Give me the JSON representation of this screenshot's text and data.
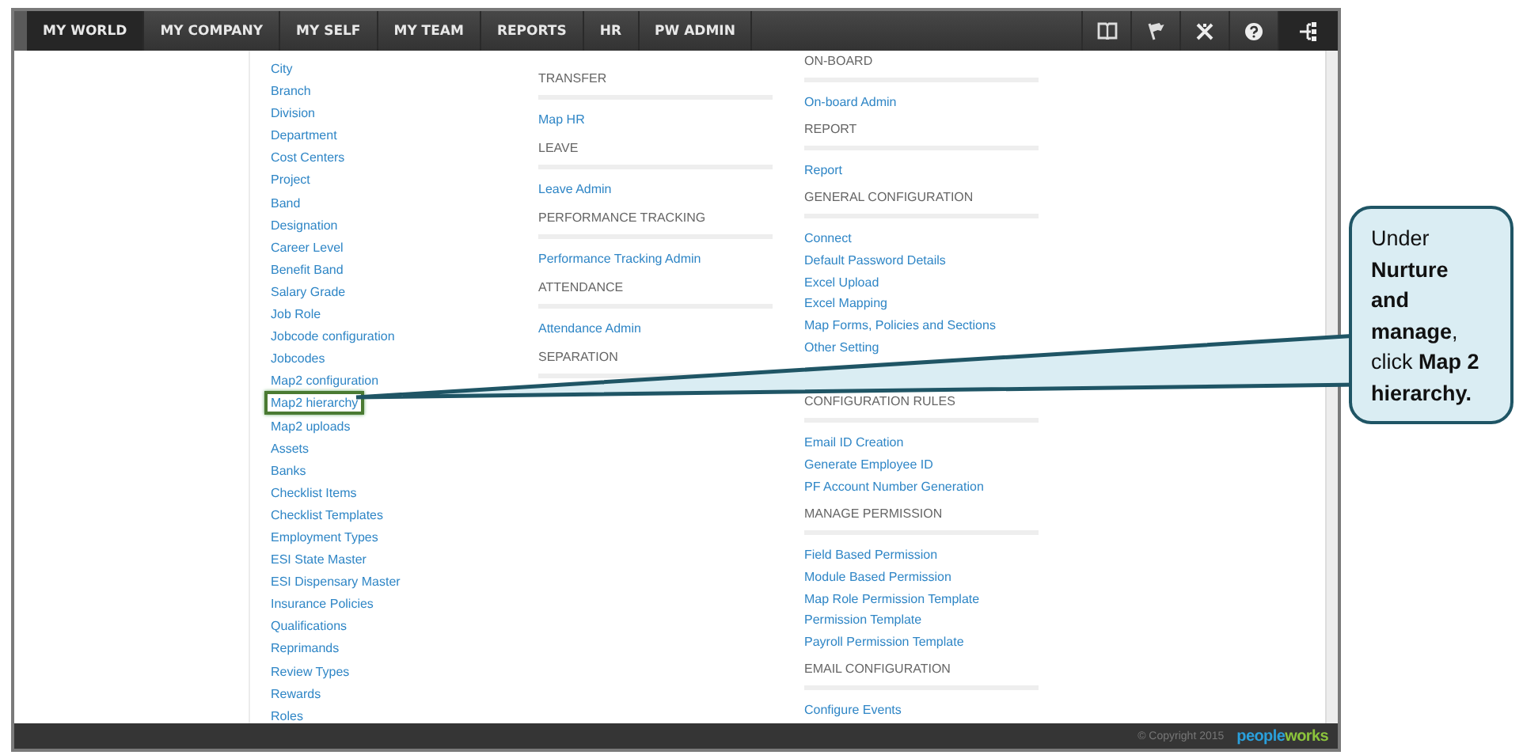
{
  "nav": {
    "tabs": [
      {
        "label": "MY WORLD",
        "selected": true
      },
      {
        "label": "MY COMPANY",
        "selected": false
      },
      {
        "label": "MY SELF",
        "selected": false
      },
      {
        "label": "MY TEAM",
        "selected": false
      },
      {
        "label": "REPORTS",
        "selected": false
      },
      {
        "label": "HR",
        "selected": false
      },
      {
        "label": "PW ADMIN",
        "selected": false
      }
    ],
    "icons": [
      {
        "kind": "book",
        "selected": false
      },
      {
        "kind": "flag",
        "selected": false
      },
      {
        "kind": "tools",
        "selected": false
      },
      {
        "kind": "help",
        "selected": false
      },
      {
        "kind": "hierarchy",
        "selected": true
      }
    ]
  },
  "column_1": {
    "items": [
      {
        "label": "City",
        "highlighted": false
      },
      {
        "label": "Branch",
        "highlighted": false
      },
      {
        "label": "Division",
        "highlighted": false
      },
      {
        "label": "Department",
        "highlighted": false
      },
      {
        "label": "Cost Centers",
        "highlighted": false
      },
      {
        "label": "Project",
        "highlighted": false
      },
      {
        "label": "Band",
        "highlighted": false
      },
      {
        "label": "Designation",
        "highlighted": false
      },
      {
        "label": "Career Level",
        "highlighted": false
      },
      {
        "label": "Benefit Band",
        "highlighted": false
      },
      {
        "label": "Salary Grade",
        "highlighted": false
      },
      {
        "label": "Job Role",
        "highlighted": false
      },
      {
        "label": "Jobcode configuration",
        "highlighted": false
      },
      {
        "label": "Jobcodes",
        "highlighted": false
      },
      {
        "label": "Map2 configuration",
        "highlighted": false
      },
      {
        "label": "Map2 hierarchy",
        "highlighted": true
      },
      {
        "label": "Map2 uploads",
        "highlighted": false
      },
      {
        "label": "Assets",
        "highlighted": false
      },
      {
        "label": "Banks",
        "highlighted": false
      },
      {
        "label": "Checklist Items",
        "highlighted": false
      },
      {
        "label": "Checklist Templates",
        "highlighted": false
      },
      {
        "label": "Employment Types",
        "highlighted": false
      },
      {
        "label": "ESI State Master",
        "highlighted": false
      },
      {
        "label": "ESI Dispensary Master",
        "highlighted": false
      },
      {
        "label": "Insurance Policies",
        "highlighted": false
      },
      {
        "label": "Qualifications",
        "highlighted": false
      },
      {
        "label": "Reprimands",
        "highlighted": false
      },
      {
        "label": "Review Types",
        "highlighted": false
      },
      {
        "label": "Rewards",
        "highlighted": false
      },
      {
        "label": "Roles",
        "highlighted": false
      }
    ]
  },
  "column_2": {
    "sections": [
      {
        "heading": "TRANSFER",
        "items": [
          "Map HR"
        ]
      },
      {
        "heading": "LEAVE",
        "items": [
          "Leave Admin"
        ]
      },
      {
        "heading": "PERFORMANCE TRACKING",
        "items": [
          "Performance Tracking Admin"
        ]
      },
      {
        "heading": "ATTENDANCE",
        "items": [
          "Attendance Admin"
        ]
      },
      {
        "heading": "SEPARATION"
      }
    ]
  },
  "column_3": {
    "sections": [
      {
        "heading": "ON-BOARD",
        "items": [
          "On-board Admin"
        ]
      },
      {
        "heading": "REPORT",
        "items": [
          "Report"
        ]
      },
      {
        "heading": "GENERAL CONFIGURATION",
        "items": [
          "Connect",
          "Default Password Details",
          "Excel Upload",
          "Excel Mapping",
          "Map Forms, Policies and Sections",
          "Other Setting"
        ]
      },
      {
        "heading": "CONFIGURATION RULES",
        "items": [
          "Email ID Creation",
          "Generate Employee ID",
          "PF Account Number Generation"
        ]
      },
      {
        "heading": "MANAGE PERMISSION",
        "items": [
          "Field Based Permission",
          "Module Based Permission",
          "Map Role Permission Template",
          "Permission Template",
          "Payroll Permission Template"
        ]
      },
      {
        "heading": "EMAIL CONFIGURATION",
        "items": [
          "Configure Events"
        ]
      }
    ]
  },
  "footer": {
    "copyright": "© Copyright 2015",
    "logo": [
      "people",
      "works"
    ]
  },
  "callout": {
    "text": "Under **Nurture and manage**, click **Map 2 hierarchy.**"
  }
}
